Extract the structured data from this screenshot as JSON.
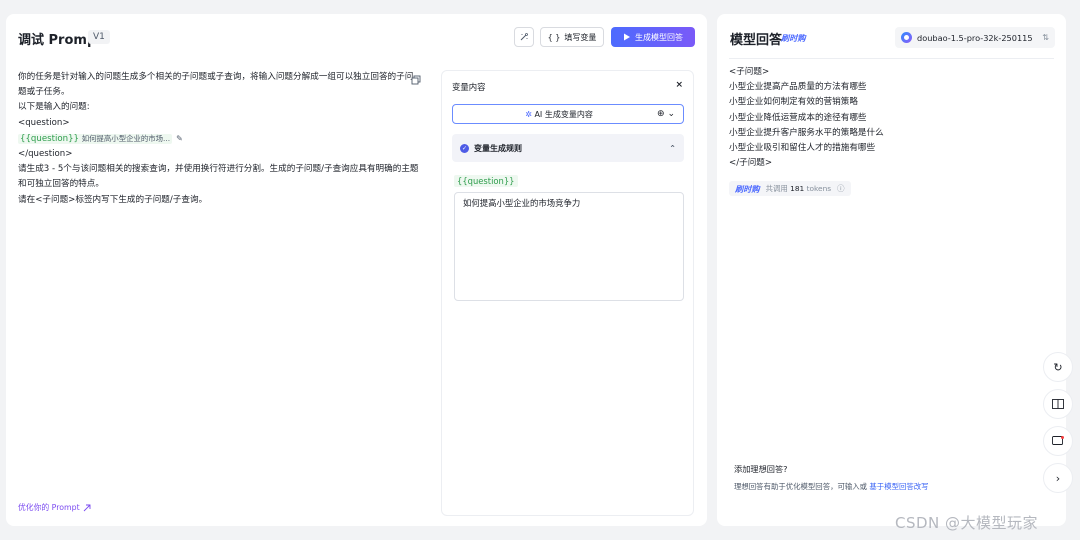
{
  "left": {
    "title": "调试 Prompt",
    "version": "V1",
    "fill_vars_label": "填写变量",
    "generate_label": "生成模型回答",
    "prompt_lines": [
      "你的任务是针对输入的问题生成多个相关的子问题或子查询，将输入问题分解成一组可以独立回答的子问",
      "题或子任务。",
      "以下是输入的问题:",
      "<question>"
    ],
    "var_chip": "{{question}}",
    "var_chip_value": "如何提高小型企业的市场...",
    "prompt_lines_after": [
      "</question>",
      "请生成3 - 5个与该问题相关的搜索查询，并使用换行符进行分割。生成的子问题/子查询应具有明确的主题",
      "和可独立回答的特点。",
      "请在<子问题>标签内写下生成的子问题/子查询。"
    ],
    "optimize_link": "优化你的 Prompt"
  },
  "variables": {
    "title": "变量内容",
    "close": "×",
    "ai_generate": "AI 生成变量内容",
    "rule_label": "变量生成规则",
    "var_tag": "{{question}}",
    "var_value": "如何提高小型企业的市场竞争力"
  },
  "right": {
    "title": "模型回答",
    "realtime_badge": "刷时购",
    "model_name": "doubao-1.5-pro-32k-250115",
    "answer_lines": [
      "<子问题>",
      "小型企业提高产品质量的方法有哪些",
      "小型企业如何制定有效的营销策略",
      "小型企业降低运营成本的途径有哪些",
      "小型企业提升客户服务水平的策略是什么",
      "小型企业吸引和留住人才的措施有哪些",
      "</子问题>"
    ],
    "token_badge": "刷时购",
    "token_text_prefix": "共调用",
    "token_count": "181",
    "token_suffix": "tokens",
    "ideal_title": "添加理想回答?",
    "ideal_desc": "理想回答有助于优化模型回答，可输入或",
    "ideal_link": "基于模型回答改写"
  },
  "watermark": "CSDN @大模型玩家",
  "icons": {
    "magic": "magic-wand-icon",
    "braces": "braces-icon",
    "play": "play-icon",
    "copy": "copy-icon",
    "edit": "pencil-icon",
    "globe": "globe-icon",
    "check": "check-circle-icon",
    "swap": "swap-icon",
    "info": "info-icon",
    "history": "history-icon",
    "book": "book-icon",
    "feedback": "feedback-icon",
    "next": "chevron-right-icon"
  },
  "colors": {
    "accent": "#4e6bff",
    "variable_green": "#2e9d4c",
    "link_purple": "#7a4af0"
  }
}
